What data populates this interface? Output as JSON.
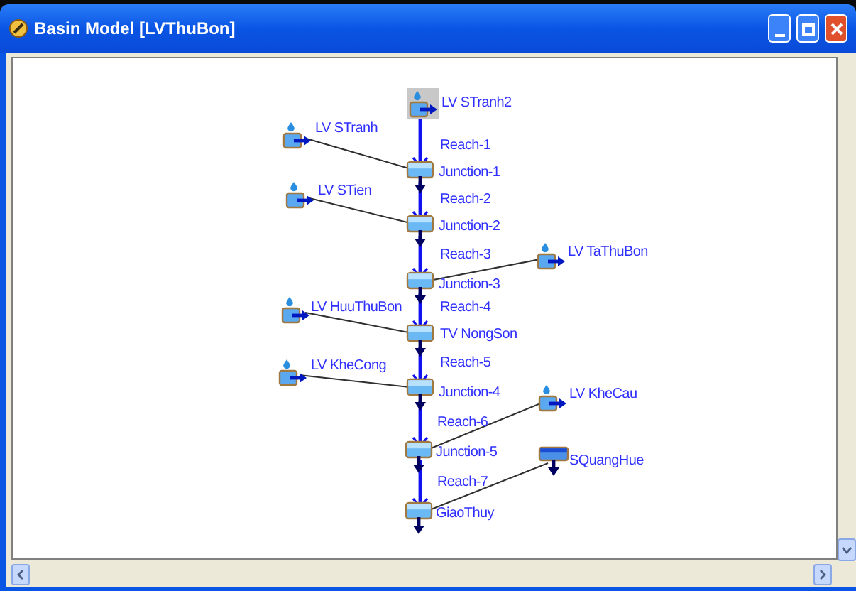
{
  "window": {
    "title": "Basin Model [LVThuBon]"
  },
  "elements": [
    {
      "kind": "subbasin",
      "label": "LV STranh2",
      "selected": true
    },
    {
      "kind": "subbasin",
      "label": "LV STranh",
      "selected": false
    },
    {
      "kind": "reach",
      "label": "Reach-1",
      "selected": false
    },
    {
      "kind": "junction",
      "label": "Junction-1",
      "selected": false
    },
    {
      "kind": "subbasin",
      "label": "LV STien",
      "selected": false
    },
    {
      "kind": "reach",
      "label": "Reach-2",
      "selected": false
    },
    {
      "kind": "junction",
      "label": "Junction-2",
      "selected": false
    },
    {
      "kind": "reach",
      "label": "Reach-3",
      "selected": false
    },
    {
      "kind": "subbasin",
      "label": "LV TaThuBon",
      "selected": false
    },
    {
      "kind": "junction",
      "label": "Junction-3",
      "selected": false
    },
    {
      "kind": "subbasin",
      "label": "LV HuuThuBon",
      "selected": false
    },
    {
      "kind": "reach",
      "label": "Reach-4",
      "selected": false
    },
    {
      "kind": "junction",
      "label": "TV NongSon",
      "selected": false
    },
    {
      "kind": "subbasin",
      "label": "LV KheCong",
      "selected": false
    },
    {
      "kind": "reach",
      "label": "Reach-5",
      "selected": false
    },
    {
      "kind": "junction",
      "label": "Junction-4",
      "selected": false
    },
    {
      "kind": "subbasin",
      "label": "LV KheCau",
      "selected": false
    },
    {
      "kind": "reach",
      "label": "Reach-6",
      "selected": false
    },
    {
      "kind": "junction",
      "label": "Junction-5",
      "selected": false
    },
    {
      "kind": "reservoir",
      "label": "SQuangHue",
      "selected": false
    },
    {
      "kind": "reach",
      "label": "Reach-7",
      "selected": false
    },
    {
      "kind": "junction",
      "label": "GiaoThuy",
      "selected": false
    }
  ]
}
